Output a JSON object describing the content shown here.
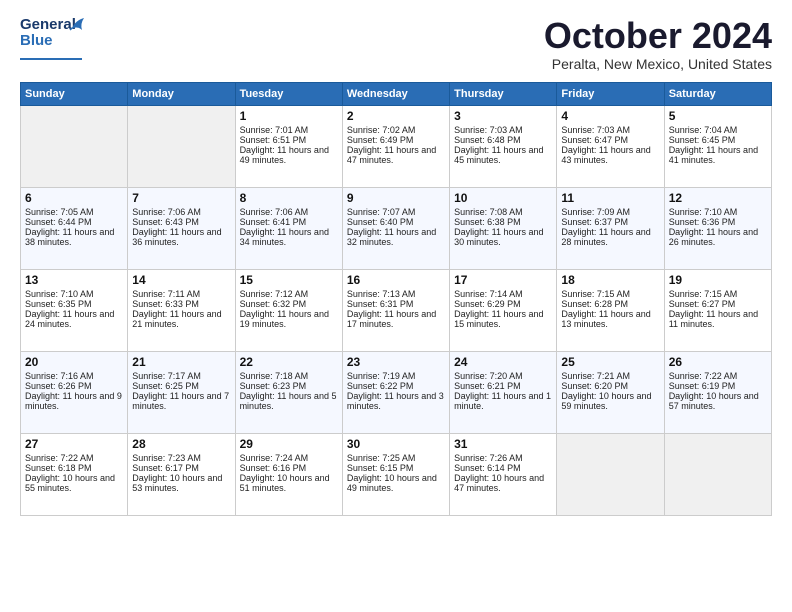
{
  "header": {
    "logo": "GeneralBlue",
    "month": "October 2024",
    "location": "Peralta, New Mexico, United States"
  },
  "weekdays": [
    "Sunday",
    "Monday",
    "Tuesday",
    "Wednesday",
    "Thursday",
    "Friday",
    "Saturday"
  ],
  "weeks": [
    [
      {
        "day": "",
        "empty": true
      },
      {
        "day": "",
        "empty": true
      },
      {
        "day": "1",
        "sunrise": "Sunrise: 7:01 AM",
        "sunset": "Sunset: 6:51 PM",
        "daylight": "Daylight: 11 hours and 49 minutes."
      },
      {
        "day": "2",
        "sunrise": "Sunrise: 7:02 AM",
        "sunset": "Sunset: 6:49 PM",
        "daylight": "Daylight: 11 hours and 47 minutes."
      },
      {
        "day": "3",
        "sunrise": "Sunrise: 7:03 AM",
        "sunset": "Sunset: 6:48 PM",
        "daylight": "Daylight: 11 hours and 45 minutes."
      },
      {
        "day": "4",
        "sunrise": "Sunrise: 7:03 AM",
        "sunset": "Sunset: 6:47 PM",
        "daylight": "Daylight: 11 hours and 43 minutes."
      },
      {
        "day": "5",
        "sunrise": "Sunrise: 7:04 AM",
        "sunset": "Sunset: 6:45 PM",
        "daylight": "Daylight: 11 hours and 41 minutes."
      }
    ],
    [
      {
        "day": "6",
        "sunrise": "Sunrise: 7:05 AM",
        "sunset": "Sunset: 6:44 PM",
        "daylight": "Daylight: 11 hours and 38 minutes."
      },
      {
        "day": "7",
        "sunrise": "Sunrise: 7:06 AM",
        "sunset": "Sunset: 6:43 PM",
        "daylight": "Daylight: 11 hours and 36 minutes."
      },
      {
        "day": "8",
        "sunrise": "Sunrise: 7:06 AM",
        "sunset": "Sunset: 6:41 PM",
        "daylight": "Daylight: 11 hours and 34 minutes."
      },
      {
        "day": "9",
        "sunrise": "Sunrise: 7:07 AM",
        "sunset": "Sunset: 6:40 PM",
        "daylight": "Daylight: 11 hours and 32 minutes."
      },
      {
        "day": "10",
        "sunrise": "Sunrise: 7:08 AM",
        "sunset": "Sunset: 6:38 PM",
        "daylight": "Daylight: 11 hours and 30 minutes."
      },
      {
        "day": "11",
        "sunrise": "Sunrise: 7:09 AM",
        "sunset": "Sunset: 6:37 PM",
        "daylight": "Daylight: 11 hours and 28 minutes."
      },
      {
        "day": "12",
        "sunrise": "Sunrise: 7:10 AM",
        "sunset": "Sunset: 6:36 PM",
        "daylight": "Daylight: 11 hours and 26 minutes."
      }
    ],
    [
      {
        "day": "13",
        "sunrise": "Sunrise: 7:10 AM",
        "sunset": "Sunset: 6:35 PM",
        "daylight": "Daylight: 11 hours and 24 minutes."
      },
      {
        "day": "14",
        "sunrise": "Sunrise: 7:11 AM",
        "sunset": "Sunset: 6:33 PM",
        "daylight": "Daylight: 11 hours and 21 minutes."
      },
      {
        "day": "15",
        "sunrise": "Sunrise: 7:12 AM",
        "sunset": "Sunset: 6:32 PM",
        "daylight": "Daylight: 11 hours and 19 minutes."
      },
      {
        "day": "16",
        "sunrise": "Sunrise: 7:13 AM",
        "sunset": "Sunset: 6:31 PM",
        "daylight": "Daylight: 11 hours and 17 minutes."
      },
      {
        "day": "17",
        "sunrise": "Sunrise: 7:14 AM",
        "sunset": "Sunset: 6:29 PM",
        "daylight": "Daylight: 11 hours and 15 minutes."
      },
      {
        "day": "18",
        "sunrise": "Sunrise: 7:15 AM",
        "sunset": "Sunset: 6:28 PM",
        "daylight": "Daylight: 11 hours and 13 minutes."
      },
      {
        "day": "19",
        "sunrise": "Sunrise: 7:15 AM",
        "sunset": "Sunset: 6:27 PM",
        "daylight": "Daylight: 11 hours and 11 minutes."
      }
    ],
    [
      {
        "day": "20",
        "sunrise": "Sunrise: 7:16 AM",
        "sunset": "Sunset: 6:26 PM",
        "daylight": "Daylight: 11 hours and 9 minutes."
      },
      {
        "day": "21",
        "sunrise": "Sunrise: 7:17 AM",
        "sunset": "Sunset: 6:25 PM",
        "daylight": "Daylight: 11 hours and 7 minutes."
      },
      {
        "day": "22",
        "sunrise": "Sunrise: 7:18 AM",
        "sunset": "Sunset: 6:23 PM",
        "daylight": "Daylight: 11 hours and 5 minutes."
      },
      {
        "day": "23",
        "sunrise": "Sunrise: 7:19 AM",
        "sunset": "Sunset: 6:22 PM",
        "daylight": "Daylight: 11 hours and 3 minutes."
      },
      {
        "day": "24",
        "sunrise": "Sunrise: 7:20 AM",
        "sunset": "Sunset: 6:21 PM",
        "daylight": "Daylight: 11 hours and 1 minute."
      },
      {
        "day": "25",
        "sunrise": "Sunrise: 7:21 AM",
        "sunset": "Sunset: 6:20 PM",
        "daylight": "Daylight: 10 hours and 59 minutes."
      },
      {
        "day": "26",
        "sunrise": "Sunrise: 7:22 AM",
        "sunset": "Sunset: 6:19 PM",
        "daylight": "Daylight: 10 hours and 57 minutes."
      }
    ],
    [
      {
        "day": "27",
        "sunrise": "Sunrise: 7:22 AM",
        "sunset": "Sunset: 6:18 PM",
        "daylight": "Daylight: 10 hours and 55 minutes."
      },
      {
        "day": "28",
        "sunrise": "Sunrise: 7:23 AM",
        "sunset": "Sunset: 6:17 PM",
        "daylight": "Daylight: 10 hours and 53 minutes."
      },
      {
        "day": "29",
        "sunrise": "Sunrise: 7:24 AM",
        "sunset": "Sunset: 6:16 PM",
        "daylight": "Daylight: 10 hours and 51 minutes."
      },
      {
        "day": "30",
        "sunrise": "Sunrise: 7:25 AM",
        "sunset": "Sunset: 6:15 PM",
        "daylight": "Daylight: 10 hours and 49 minutes."
      },
      {
        "day": "31",
        "sunrise": "Sunrise: 7:26 AM",
        "sunset": "Sunset: 6:14 PM",
        "daylight": "Daylight: 10 hours and 47 minutes."
      },
      {
        "day": "",
        "empty": true
      },
      {
        "day": "",
        "empty": true
      }
    ]
  ]
}
